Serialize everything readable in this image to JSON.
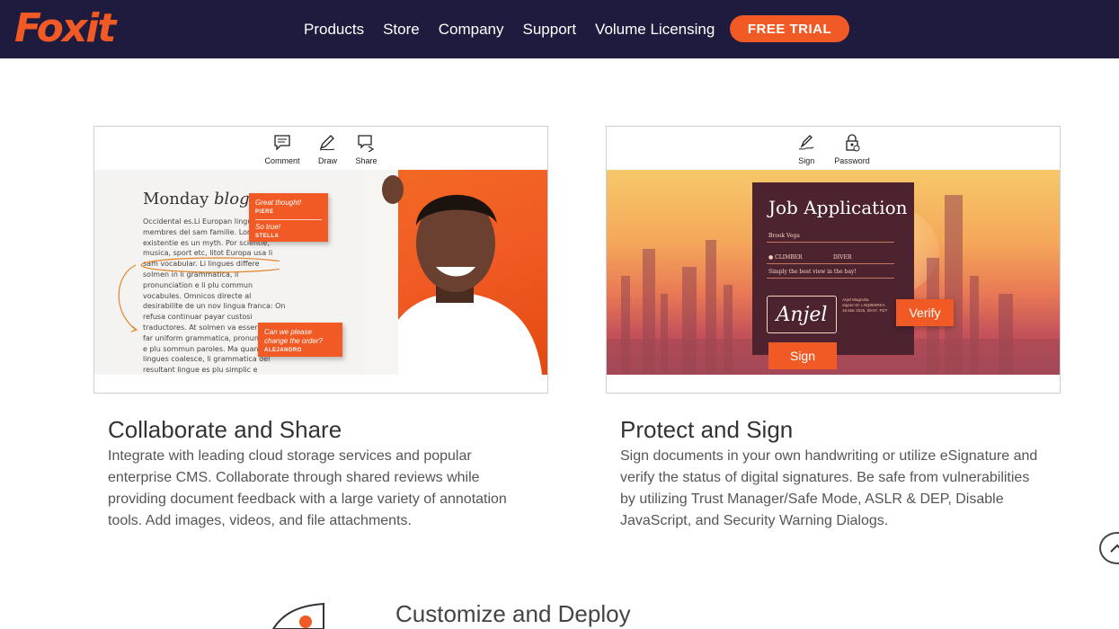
{
  "header": {
    "logo_text": "Foxit",
    "nav": [
      "Products",
      "Store",
      "Company",
      "Support",
      "Volume Licensing"
    ],
    "cta_label": "FREE TRIAL"
  },
  "colors": {
    "header_bg": "#1f1b3f",
    "accent": "#f15a24"
  },
  "features": [
    {
      "toolbar": [
        {
          "icon": "comment-icon",
          "label": "Comment"
        },
        {
          "icon": "pencil-icon",
          "label": "Draw"
        },
        {
          "icon": "share-icon",
          "label": "Share"
        }
      ],
      "blog": {
        "title": "Monday",
        "title_italic": "blog",
        "text": "Occidental es.Li Europan lingues es membres del sam familie. Lor separat existentie es un myth. Por scientie, musica, sport etc, litot Europa usa li sam vocabular. Li lingues differe solmen in li grammatica, li pronunciation e li plu commun vocabules. Omnicos directe al desirabilite de un nov lingua franca: On refusa continuar payar custosi traductores. At solmen va esser necessi far uniform grammatica, pronunciation e plu sommun paroles. Ma quande lingues coalesce, li grammatica del resultant lingue es plu simplic e regulari quam ti del",
        "notes": [
          {
            "quote": "Great thought!",
            "author": "PIERE"
          },
          {
            "quote": "So true!",
            "author": "STELLA"
          },
          {
            "quote": "Can we please change the order?",
            "author": "ALEJANDRO"
          }
        ]
      },
      "title": "Collaborate and Share",
      "description": "Integrate with leading cloud storage services and popular enterprise CMS. Collaborate through shared reviews while providing document feedback with a large variety of annotation tools. Add images, videos, and file attachments."
    },
    {
      "toolbar": [
        {
          "icon": "sign-icon",
          "label": "Sign"
        },
        {
          "icon": "password-lock-icon",
          "label": "Password"
        }
      ],
      "form": {
        "title": "Job Application",
        "name": "Brook Vega",
        "option1": "CLIMBER",
        "option2": "DIVER",
        "tagline": "Simply the best view in the bay!",
        "signature": "Anjel",
        "signer_name": "Anjel Magnolia",
        "signer_id": "Signer ID: LNQ8E8RKA",
        "signed_date": "18 Mar 2025, 09:07, PDT",
        "verify_label": "Verify",
        "sign_label": "Sign"
      },
      "title": "Protect and Sign",
      "description": "Sign documents in your own handwriting or utilize eSignature and verify the status of digital signatures. Be safe from vulnerabilities by utilizing Trust Manager/Safe Mode, ASLR & DEP, Disable JavaScript, and Security Warning Dialogs."
    }
  ],
  "next_section": {
    "title": "Customize and Deploy"
  }
}
